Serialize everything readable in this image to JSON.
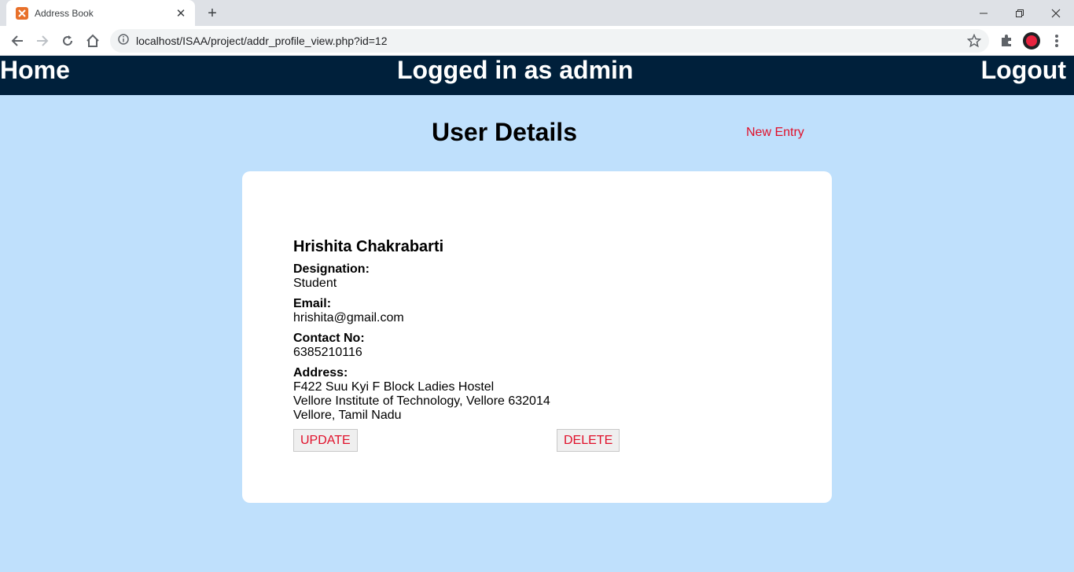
{
  "browser": {
    "tab_title": "Address Book",
    "url": "localhost/ISAA/project/addr_profile_view.php?id=12"
  },
  "nav": {
    "home": "Home",
    "status": "Logged in as admin",
    "logout": "Logout"
  },
  "page": {
    "title": "User Details",
    "new_entry": "New Entry"
  },
  "profile": {
    "name": "Hrishita Chakrabarti",
    "designation_label": "Designation:",
    "designation": "Student",
    "email_label": "Email:",
    "email": "hrishita@gmail.com",
    "contact_label": "Contact No:",
    "contact": "6385210116",
    "address_label": "Address:",
    "address_line1": "F422 Suu Kyi F Block Ladies Hostel",
    "address_line2": "Vellore Institute of Technology, Vellore 632014",
    "address_line3": "Vellore, Tamil Nadu"
  },
  "actions": {
    "update": "UPDATE",
    "delete": "DELETE"
  },
  "colors": {
    "nav_bg": "#00203b",
    "page_bg": "#bfe0fc",
    "link_red": "#e0102a"
  }
}
